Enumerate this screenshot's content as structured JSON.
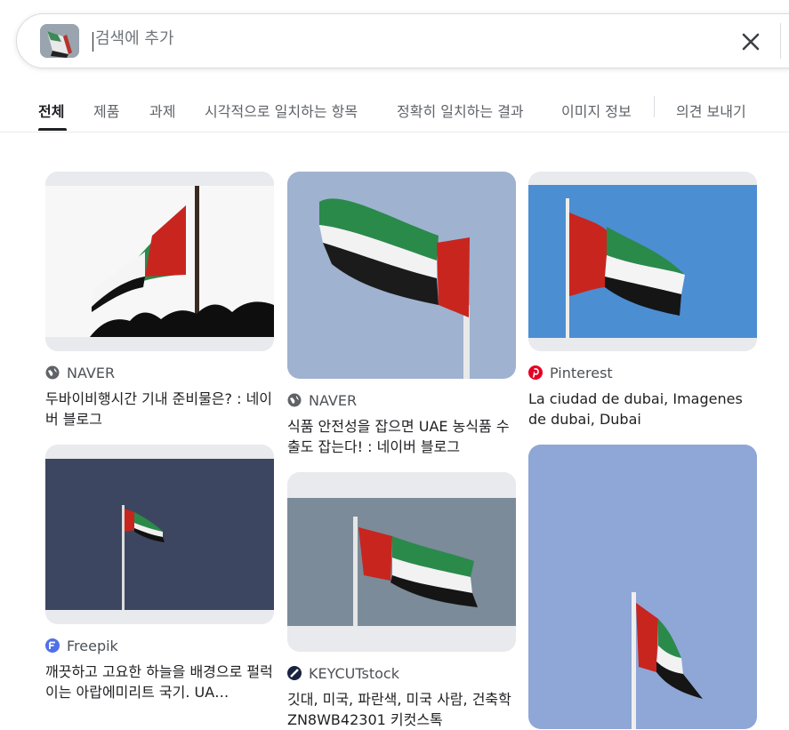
{
  "search": {
    "placeholder": "검색에 추가",
    "value": ""
  },
  "icons": {
    "clear": "close-icon",
    "globe": "globe-icon",
    "pinterest": "pinterest-icon",
    "freepik": "freepik-icon",
    "keycut": "keycut-icon"
  },
  "tabs": [
    {
      "label": "전체",
      "active": true
    },
    {
      "label": "제품"
    },
    {
      "label": "과제"
    },
    {
      "label": "시각적으로 일치하는 항목"
    },
    {
      "label": "정확히 일치하는 결과"
    },
    {
      "label": "이미지 정보"
    },
    {
      "label": "의견 보내기"
    }
  ],
  "results": [
    {
      "source": "NAVER",
      "caption": "두바이비행시간 기내 준비물은? : 네이버 블로그"
    },
    {
      "source": "NAVER",
      "caption": "식품 안전성을 잡으면 UAE 농식품 수출도 잡는다! : 네이버 블로그"
    },
    {
      "source": "Pinterest",
      "caption": "La ciudad de dubai, Imagenes de dubai, Dubai"
    },
    {
      "source": "Freepik",
      "caption": "깨끗하고 고요한 하늘을 배경으로 펄럭이는 아랍에미리트 국기. UA…"
    },
    {
      "source": "KEYCUTstock",
      "caption": "깃대, 미국, 파란색, 미국 사람, 건축학 ZN8WB42301 키컷스톡"
    },
    {
      "source": "",
      "caption": ""
    }
  ],
  "colors": {
    "flag_red": "#c8251f",
    "flag_green": "#2a8a4a",
    "flag_black": "#1a1a1a",
    "tab_active": "#202124",
    "tab_inactive": "#5f6368"
  }
}
